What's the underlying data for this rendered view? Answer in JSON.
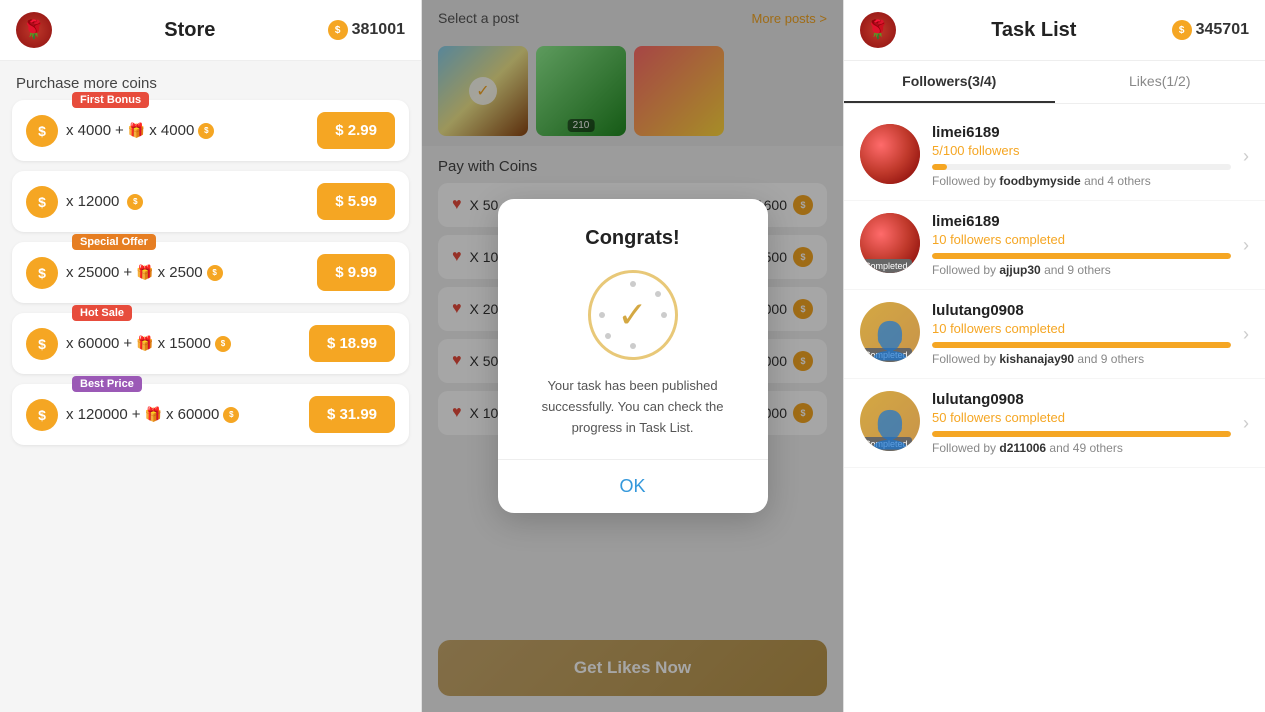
{
  "store": {
    "title": "Store",
    "balance": "381001",
    "purchase_label": "Purchase more coins",
    "items": [
      {
        "coins": "x 4000",
        "bonus_gift": "x 4000",
        "price": "$ 2.99",
        "badge": "First Bonus",
        "badge_type": "first",
        "has_bonus": true
      },
      {
        "coins": "x 12000",
        "price": "$ 5.99",
        "has_bonus": false
      },
      {
        "coins": "x 25000",
        "bonus_gift": "x 2500",
        "price": "$ 9.99",
        "badge": "Special Offer",
        "badge_type": "special",
        "has_bonus": true
      },
      {
        "coins": "x 60000",
        "bonus_gift": "x 15000",
        "price": "$ 18.99",
        "badge": "Hot Sale",
        "badge_type": "hot",
        "has_bonus": true
      },
      {
        "coins": "x 120000",
        "bonus_gift": "x 60000",
        "price": "$ 31.99",
        "badge": "Best Price",
        "badge_type": "best",
        "has_bonus": true
      }
    ]
  },
  "middle": {
    "select_post_label": "Select a post",
    "more_posts_label": "More posts >",
    "pay_with_coins_label": "Pay with Coins",
    "posts": [
      {
        "has_check": true,
        "likes": ""
      },
      {
        "has_check": false,
        "likes": "210"
      },
      {
        "has_check": false,
        "likes": ""
      }
    ],
    "pay_items": [
      {
        "quantity": "X 50",
        "cost": "1600"
      },
      {
        "quantity": "X 100",
        "cost": "2500"
      },
      {
        "quantity": "X 200",
        "cost": "5000"
      },
      {
        "quantity": "X 500",
        "cost": "12000"
      },
      {
        "quantity": "X 100",
        "cost": "20000"
      }
    ],
    "get_likes_btn": "Get Likes Now"
  },
  "modal": {
    "title": "Congrats!",
    "message": "Your task has been published successfully. You can check the progress in Task List.",
    "ok_label": "OK"
  },
  "task_list": {
    "title": "Task List",
    "balance": "345701",
    "tabs": [
      {
        "label": "Followers(3/4)",
        "active": true
      },
      {
        "label": "Likes(1/2)",
        "active": false
      }
    ],
    "items": [
      {
        "username": "limei6189",
        "progress_text": "5/100 followers",
        "progress_pct": 5,
        "followers_text": "Followed by",
        "highlighted": "foodbymyside",
        "suffix": "and 4 others",
        "completed": false,
        "avatar_type": "rose"
      },
      {
        "username": "limei6189",
        "progress_text": "10 followers completed",
        "progress_pct": 100,
        "followers_text": "Followed by",
        "highlighted": "ajjup30",
        "suffix": "and 9 others",
        "completed": true,
        "avatar_type": "rose"
      },
      {
        "username": "lulutang0908",
        "progress_text": "10 followers completed",
        "progress_pct": 100,
        "followers_text": "Followed by",
        "highlighted": "kishanajay90",
        "suffix": "and 9 others",
        "completed": true,
        "avatar_type": "person"
      },
      {
        "username": "lulutang0908",
        "progress_text": "50 followers completed",
        "progress_pct": 100,
        "followers_text": "Followed by",
        "highlighted": "d211006",
        "suffix": "and 49 others",
        "completed": true,
        "avatar_type": "person"
      }
    ]
  }
}
